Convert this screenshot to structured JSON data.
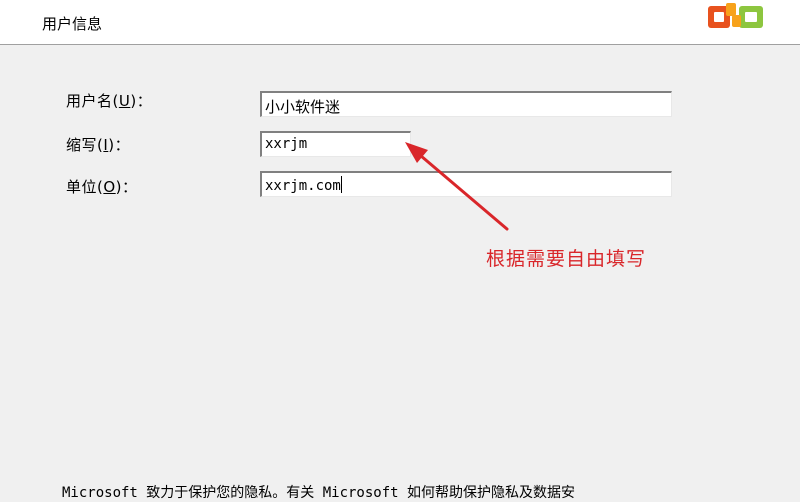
{
  "header": {
    "title": "用户信息",
    "logo_icon": "office-logo-icon",
    "logo_colors": [
      "#e8521e",
      "#f7a21b",
      "#8dc63f"
    ]
  },
  "form": {
    "username": {
      "label_prefix": "用户名(",
      "label_accel": "U",
      "label_suffix": ")：",
      "value": "小小软件迷"
    },
    "initials": {
      "label_prefix": "缩写(",
      "label_accel": "I",
      "label_suffix": ")：",
      "value": "xxrjm"
    },
    "organization": {
      "label_prefix": "单位(",
      "label_accel": "O",
      "label_suffix": ")：",
      "value": "xxrjm.com"
    }
  },
  "annotation": {
    "text": "根据需要自由填写",
    "color": "#d9262a"
  },
  "footer": {
    "privacy_text": "Microsoft 致力于保护您的隐私。有关 Microsoft 如何帮助保护隐私及数据安"
  }
}
